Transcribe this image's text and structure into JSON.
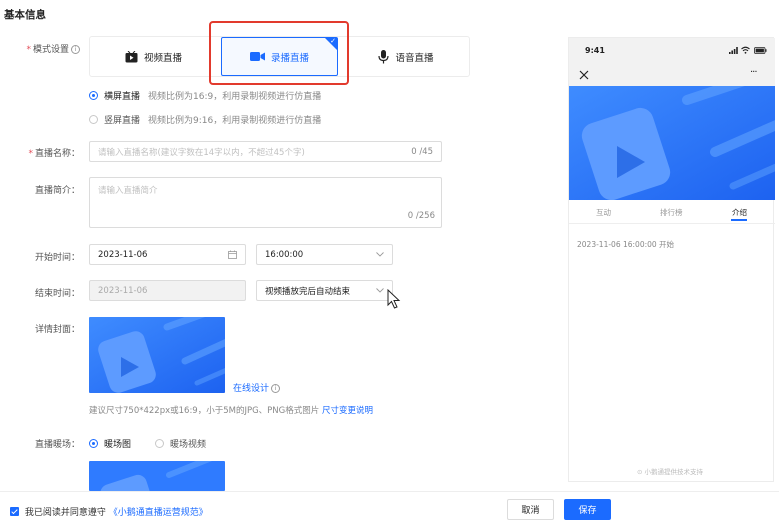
{
  "section_title": "基本信息",
  "form": {
    "mode": {
      "label": "模式设置",
      "options": [
        {
          "label": "视频直播",
          "icon": "tv-icon"
        },
        {
          "label": "录播直播",
          "icon": "video-camera-icon",
          "selected": true
        },
        {
          "label": "语音直播",
          "icon": "microphone-icon"
        }
      ],
      "orientation": [
        {
          "label": "横屏直播",
          "hint": "视频比例为16:9，利用录制视频进行仿直播",
          "checked": true
        },
        {
          "label": "竖屏直播",
          "hint": "视频比例为9:16，利用录制视频进行仿直播",
          "checked": false
        }
      ]
    },
    "name": {
      "label": "直播名称",
      "placeholder": "请输入直播名称(建议字数在14字以内，不超过45个字)",
      "count": "0 /45"
    },
    "intro": {
      "label": "直播简介",
      "placeholder": "请输入直播简介",
      "count": "0 /256"
    },
    "start": {
      "label": "开始时间",
      "date": "2023-11-06",
      "time": "16:00:00"
    },
    "end": {
      "label": "结束时间",
      "date": "2023-11-06",
      "mode": "视频播放完后自动结束"
    },
    "cover": {
      "label": "详情封面",
      "online_design": "在线设计",
      "hint": "建议尺寸750*422px或16:9，小于5M的JPG、PNG格式图片",
      "hint_link": "尺寸变更说明"
    },
    "warmup": {
      "label": "直播暖场",
      "options": [
        {
          "label": "暖场图",
          "checked": true
        },
        {
          "label": "暖场视频",
          "checked": false
        }
      ]
    }
  },
  "preview": {
    "time": "9:41",
    "tabs": [
      "互动",
      "排行榜",
      "介绍"
    ],
    "active_tab": 2,
    "start_text": "2023-11-06 16:00:00 开始",
    "footer_text": "小鹅通提供技术支持"
  },
  "footer": {
    "agree_prefix": "我已阅读并同意遵守",
    "agree_link": "《小鹅通直播运营规范》",
    "cancel": "取消",
    "save": "保存"
  },
  "colors": {
    "primary": "#1b6bff",
    "highlight": "#e23a2d"
  }
}
